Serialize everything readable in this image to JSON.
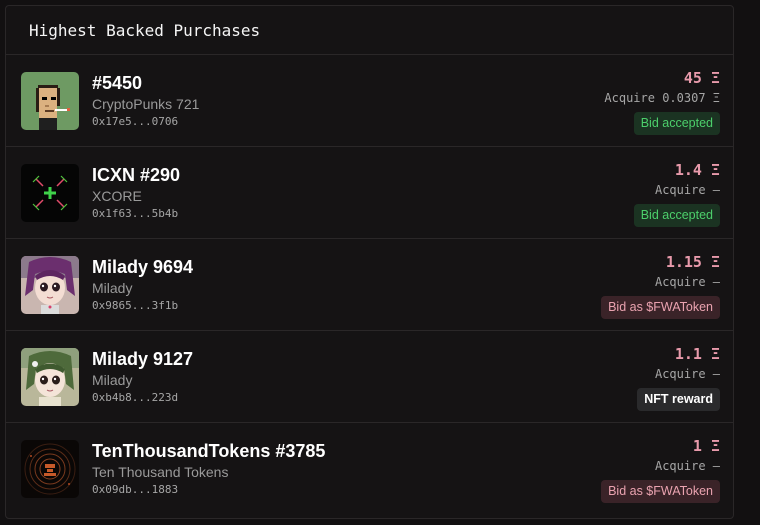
{
  "header": {
    "title": "Highest Backed Purchases"
  },
  "rows": [
    {
      "title": "#5450",
      "collection": "CryptoPunks 721",
      "address": "0x17e5...0706",
      "price": "45",
      "currency": "Ξ",
      "acquire": "Acquire 0.0307 Ξ",
      "badge": "Bid accepted",
      "badge_type": "accepted",
      "thumb": "cryptopunk-thumbnail"
    },
    {
      "title": "ICXN #290",
      "collection": "XCORE",
      "address": "0x1f63...5b4b",
      "price": "1.4",
      "currency": "Ξ",
      "acquire": "Acquire —",
      "badge": "Bid accepted",
      "badge_type": "accepted",
      "thumb": "icxn-thumbnail"
    },
    {
      "title": "Milady 9694",
      "collection": "Milady",
      "address": "0x9865...3f1b",
      "price": "1.15",
      "currency": "Ξ",
      "acquire": "Acquire —",
      "badge": "Bid as $FWAToken",
      "badge_type": "fwa",
      "thumb": "milady-thumbnail"
    },
    {
      "title": "Milady 9127",
      "collection": "Milady",
      "address": "0xb4b8...223d",
      "price": "1.1",
      "currency": "Ξ",
      "acquire": "Acquire —",
      "badge": "NFT reward",
      "badge_type": "reward",
      "thumb": "milady-thumbnail"
    },
    {
      "title": "TenThousandTokens #3785",
      "collection": "Ten Thousand Tokens",
      "address": "0x09db...1883",
      "price": "1",
      "currency": "Ξ",
      "acquire": "Acquire —",
      "badge": "Bid as $FWAToken",
      "badge_type": "fwa",
      "thumb": "tenthousandtokens-thumbnail"
    }
  ],
  "colors": {
    "background": "#121011",
    "price": "#e89aab",
    "accepted": "#4ccf6b",
    "fwa": "#eaa3b0"
  }
}
